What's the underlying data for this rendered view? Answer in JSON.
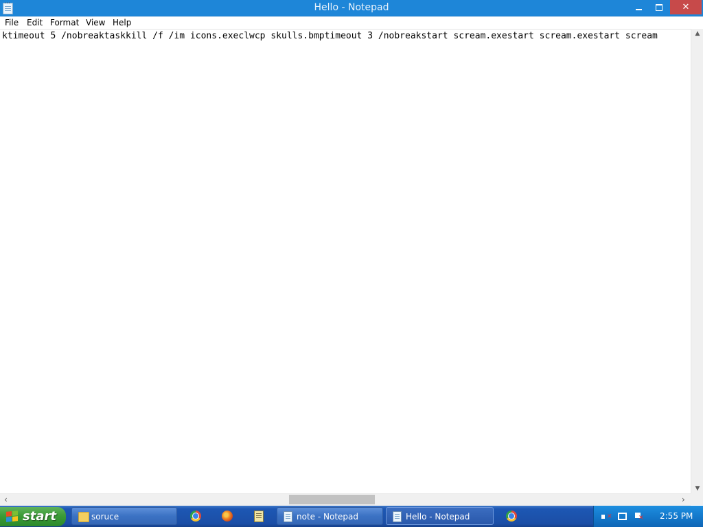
{
  "window": {
    "title": "Hello - Notepad",
    "close_glyph": "✕"
  },
  "menu": {
    "items": [
      "File",
      "Edit",
      "Format",
      "View",
      "Help"
    ]
  },
  "editor": {
    "content": "ktimeout 5 /nobreaktaskkill /f /im icons.execlwcp skulls.bmptimeout 3 /nobreakstart scream.exestart scream.exestart scream"
  },
  "scrollbar": {
    "left_arrow": "‹",
    "right_arrow": "›",
    "up_arrow": "▲",
    "down_arrow": "▼"
  },
  "taskbar": {
    "start_label": "start",
    "tasks": [
      {
        "label": "soruce",
        "icon": "folder-icon"
      },
      {
        "label": "note - Notepad",
        "icon": "notepad-icon"
      },
      {
        "label": "Hello - Notepad",
        "icon": "notepad-icon",
        "active": true
      }
    ],
    "quick_launch": [
      "chrome-icon",
      "firefox-icon",
      "notepad-icon"
    ],
    "tray_icons": [
      "volume-muted-icon",
      "network-icon",
      "action-center-icon"
    ],
    "clock": "2:55 PM"
  },
  "colors": {
    "titlebar": "#1e86d8",
    "close_button": "#c74a4a",
    "taskbar": "#1b4ea6",
    "start_button": "#3b9b37"
  }
}
